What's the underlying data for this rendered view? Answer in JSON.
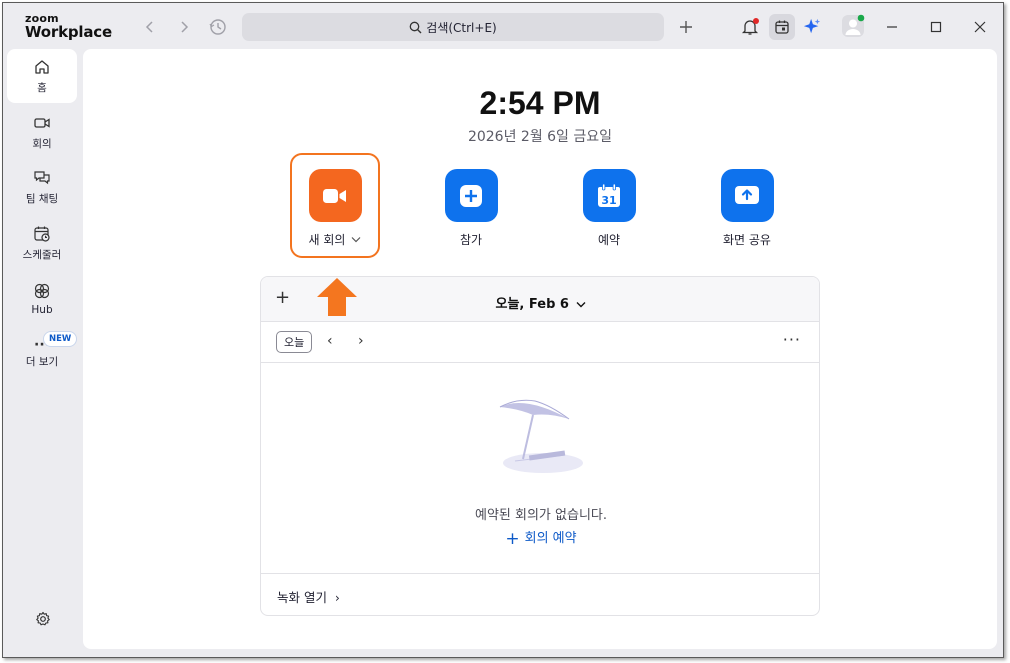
{
  "app": {
    "logo_top": "zoom",
    "logo_bottom": "Workplace"
  },
  "titlebar": {
    "search_placeholder": "검색(Ctrl+E)",
    "icons": [
      "back-arrow-icon",
      "forward-arrow-icon",
      "history-icon",
      "plus-icon",
      "bell-icon",
      "calendar-app-icon",
      "ai-companion-icon",
      "avatar-icon",
      "minimize-icon",
      "maximize-icon",
      "close-icon"
    ]
  },
  "sidebar": {
    "items": [
      {
        "label": "홈",
        "icon": "home-icon",
        "active": true
      },
      {
        "label": "회의",
        "icon": "video-icon"
      },
      {
        "label": "팀 채팅",
        "icon": "chat-icon"
      },
      {
        "label": "스케줄러",
        "icon": "scheduler-icon"
      },
      {
        "label": "Hub",
        "icon": "hub-icon"
      },
      {
        "label": "더 보기",
        "icon": "more-dots-icon"
      }
    ],
    "new_badge": "NEW",
    "dots": "···"
  },
  "main": {
    "time": "2:54 PM",
    "date": "2026년 2월 6일 금요일",
    "actions": [
      {
        "label": "새 회의",
        "icon": "video-camera-icon"
      },
      {
        "label": "참가",
        "icon": "plus-icon"
      },
      {
        "label": "예약",
        "icon": "calendar-icon",
        "calendar_day": "31"
      },
      {
        "label": "화면 공유",
        "icon": "share-screen-icon"
      }
    ],
    "card": {
      "plus": "+",
      "title": "오늘, Feb 6",
      "today_button": "오늘",
      "prev": "‹",
      "next": "›",
      "more": "···",
      "empty_text": "예약된 회의가 없습니다.",
      "schedule_link_plus": "+",
      "schedule_link": "회의 예약",
      "recordings": "녹화 열기",
      "recordings_chevron": "›"
    }
  },
  "colors": {
    "accent": "#0e72ed",
    "orange": "#f4671f",
    "highlight": "#f3741f",
    "sidebar_bg": "#ececf0"
  }
}
